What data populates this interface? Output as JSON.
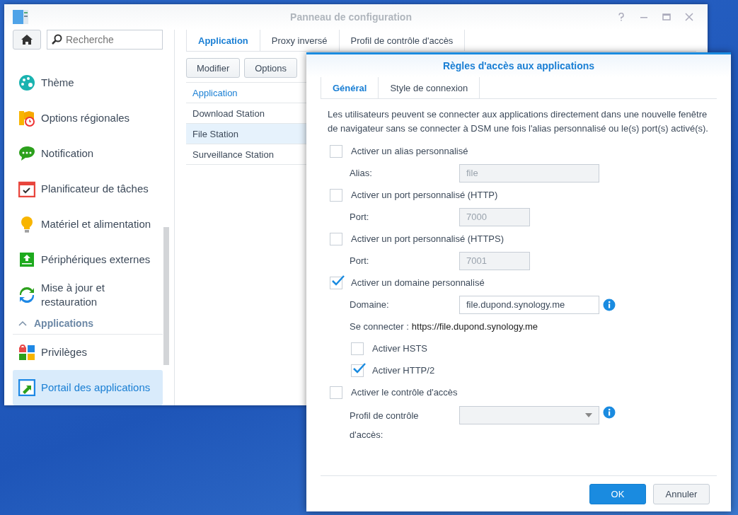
{
  "window": {
    "title": "Panneau de configuration"
  },
  "search": {
    "placeholder": "Recherche"
  },
  "sidebar": {
    "items": [
      {
        "kind": "item",
        "label": "Thème",
        "selected": false
      },
      {
        "kind": "item",
        "label": "Options régionales",
        "selected": false
      },
      {
        "kind": "item",
        "label": "Notification",
        "selected": false
      },
      {
        "kind": "item",
        "label": "Planificateur de tâches",
        "selected": false
      },
      {
        "kind": "item",
        "label": "Matériel et alimentation",
        "selected": false
      },
      {
        "kind": "item",
        "label": "Périphériques externes",
        "selected": false
      },
      {
        "kind": "item",
        "label": "Mise à jour et restauration",
        "selected": false
      },
      {
        "kind": "group",
        "label": "Applications",
        "expanded": true
      },
      {
        "kind": "item",
        "label": "Privilèges",
        "selected": false
      },
      {
        "kind": "item",
        "label": "Portail des applications",
        "selected": true
      }
    ]
  },
  "tabs": [
    {
      "label": "Application",
      "selected": true
    },
    {
      "label": "Proxy inversé",
      "selected": false
    },
    {
      "label": "Profil de contrôle d'accès",
      "selected": false
    }
  ],
  "toolbar": [
    "Modifier",
    "Options"
  ],
  "table": {
    "columns": [
      "Application"
    ],
    "rows": [
      {
        "name": "Download Station",
        "selected": false
      },
      {
        "name": "File Station",
        "selected": true
      },
      {
        "name": "Surveillance Station",
        "selected": false
      }
    ]
  },
  "dialog": {
    "title": "Règles d'accès aux applications",
    "tabs": [
      {
        "label": "Général",
        "selected": true
      },
      {
        "label": "Style de connexion",
        "selected": false
      }
    ],
    "description": "Les utilisateurs peuvent se connecter aux applications directement dans une nouvelle fenêtre de navigateur sans se connecter à DSM une fois l'alias personnalisé ou le(s) port(s) activé(s).",
    "rows": [
      {
        "kind": "checkbox",
        "label": "Activer un alias personnalisé",
        "checked": false
      },
      {
        "kind": "field",
        "label": "Alias:",
        "value": "file",
        "disabled": true
      },
      {
        "kind": "checkbox",
        "label": "Activer un port personnalisé (HTTP)",
        "checked": false
      },
      {
        "kind": "short_field",
        "label": "Port:",
        "value": "7000",
        "disabled": true
      },
      {
        "kind": "checkbox",
        "label": "Activer un port personnalisé (HTTPS)",
        "checked": false
      },
      {
        "kind": "short_field",
        "label": "Port:",
        "value": "7001",
        "disabled": true
      },
      {
        "kind": "checkbox",
        "label": "Activer un domaine personnalisé",
        "checked": true
      },
      {
        "kind": "field",
        "label": "Domaine:",
        "value": "file.dupond.synology.me",
        "disabled": false,
        "info": true
      },
      {
        "kind": "text",
        "label": "Se connecter :",
        "value": "https://file.dupond.synology.me"
      },
      {
        "kind": "subcheckbox",
        "label": "Activer HSTS",
        "checked": false
      },
      {
        "kind": "subcheckbox",
        "label": "Activer HTTP/2",
        "checked": true
      },
      {
        "kind": "checkbox",
        "label": "Activer le contrôle d'accès",
        "checked": false
      },
      {
        "kind": "select",
        "label": "Profil de contrôle d'accès:",
        "info": true
      }
    ],
    "buttons": [
      {
        "label": "OK",
        "kind": "primary"
      },
      {
        "label": "Annuler",
        "kind": "secondary"
      }
    ]
  }
}
